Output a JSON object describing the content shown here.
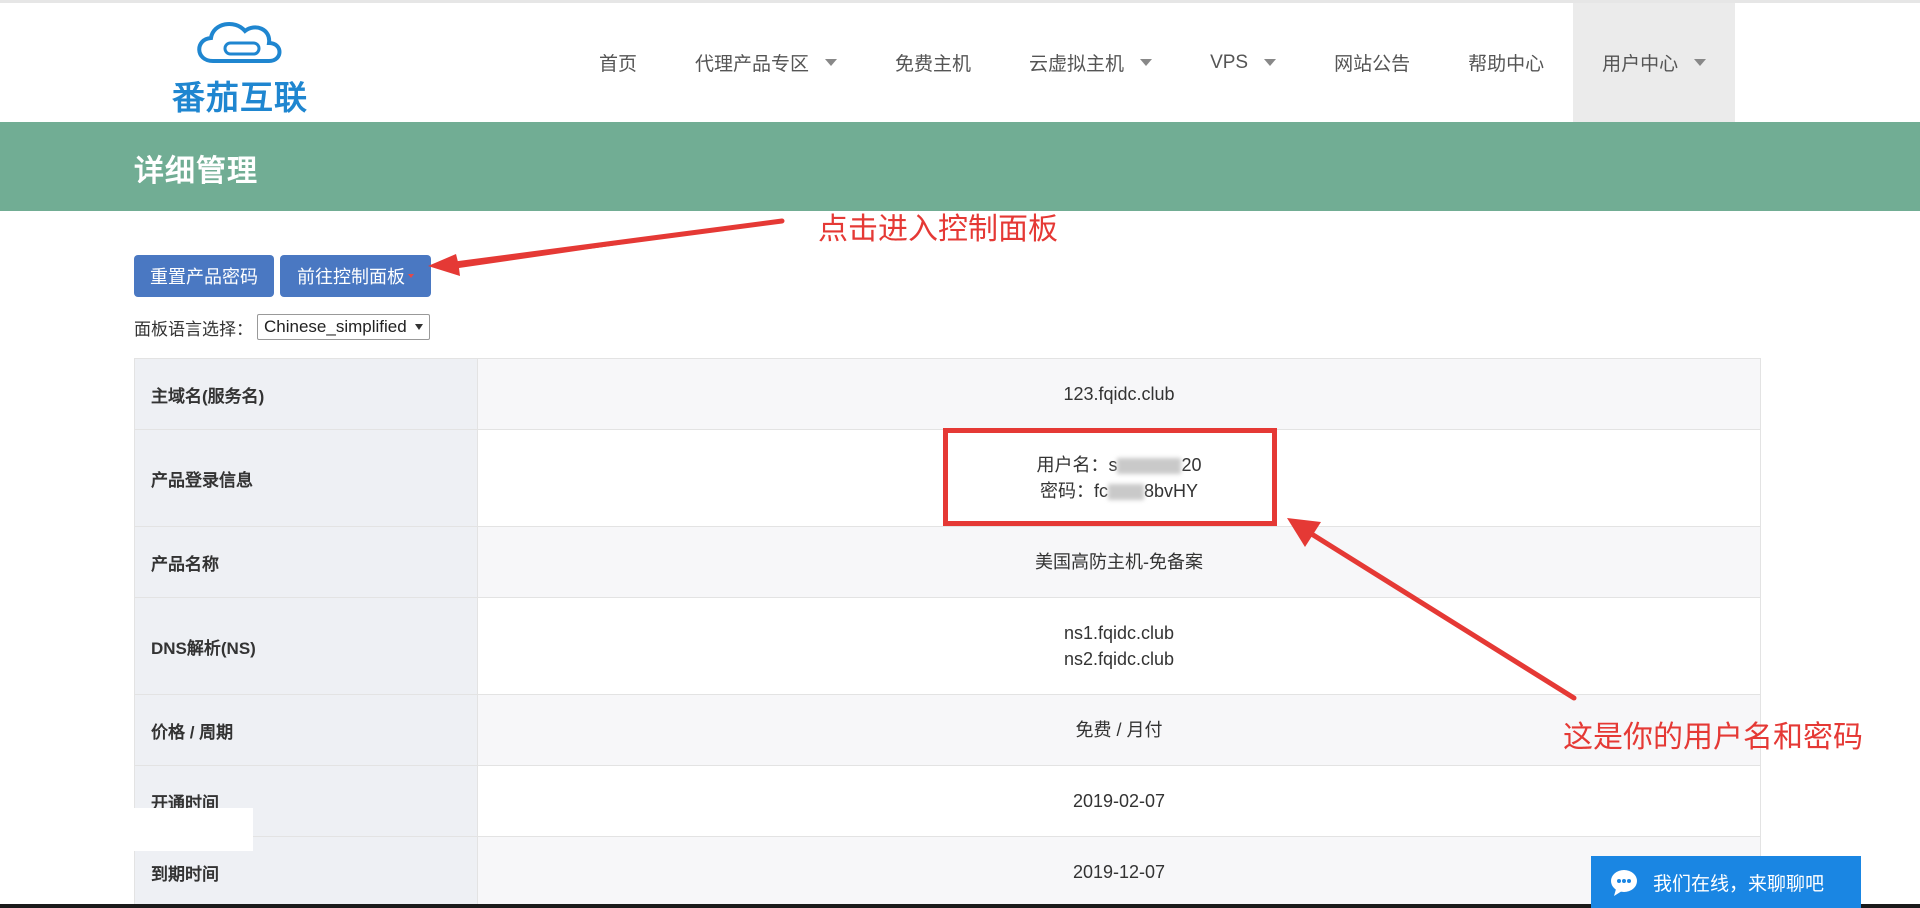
{
  "brand": {
    "logo_text": "番茄互联"
  },
  "nav": {
    "items": [
      {
        "label": "首页",
        "has_dropdown": false
      },
      {
        "label": "代理产品专区",
        "has_dropdown": true
      },
      {
        "label": "免费主机",
        "has_dropdown": false
      },
      {
        "label": "云虚拟主机",
        "has_dropdown": true
      },
      {
        "label": "VPS",
        "has_dropdown": true
      },
      {
        "label": "网站公告",
        "has_dropdown": false
      },
      {
        "label": "帮助中心",
        "has_dropdown": false
      },
      {
        "label": "用户中心",
        "has_dropdown": true,
        "active": true
      }
    ]
  },
  "page": {
    "title": "详细管理"
  },
  "actions": {
    "reset_password": "重置产品密码",
    "goto_panel": "前往控制面板"
  },
  "language": {
    "label": "面板语言选择：",
    "selected": "Chinese_simplified"
  },
  "details": {
    "main_domain": {
      "label": "主域名(服务名)",
      "value": "123.fqidc.club"
    },
    "login_info": {
      "label": "产品登录信息",
      "username_label": "用户名：",
      "username_prefix": "s",
      "username_suffix": "20",
      "password_label": "密码：",
      "password_prefix": "fc",
      "password_suffix": "8bvHY"
    },
    "product_name": {
      "label": "产品名称",
      "value": "美国高防主机-免备案"
    },
    "dns": {
      "label": "DNS解析(NS)",
      "ns1": "ns1.fqidc.club",
      "ns2": "ns2.fqidc.club"
    },
    "price": {
      "label": "价格 / 周期",
      "value": "免费 / 月付"
    },
    "open_date": {
      "label": "开通时间",
      "value": "2019-02-07"
    },
    "expire_date": {
      "label": "到期时间",
      "value": "2019-12-07"
    }
  },
  "annotations": {
    "panel_hint": "点击进入控制面板",
    "credentials_hint": "这是你的用户名和密码",
    "color": "#e53935"
  },
  "chat": {
    "label": "我们在线，来聊聊吧"
  },
  "colors": {
    "banner": "#71ad94",
    "button": "#4a78c2",
    "chat": "#1a86e3",
    "logo": "#1f86d0"
  }
}
